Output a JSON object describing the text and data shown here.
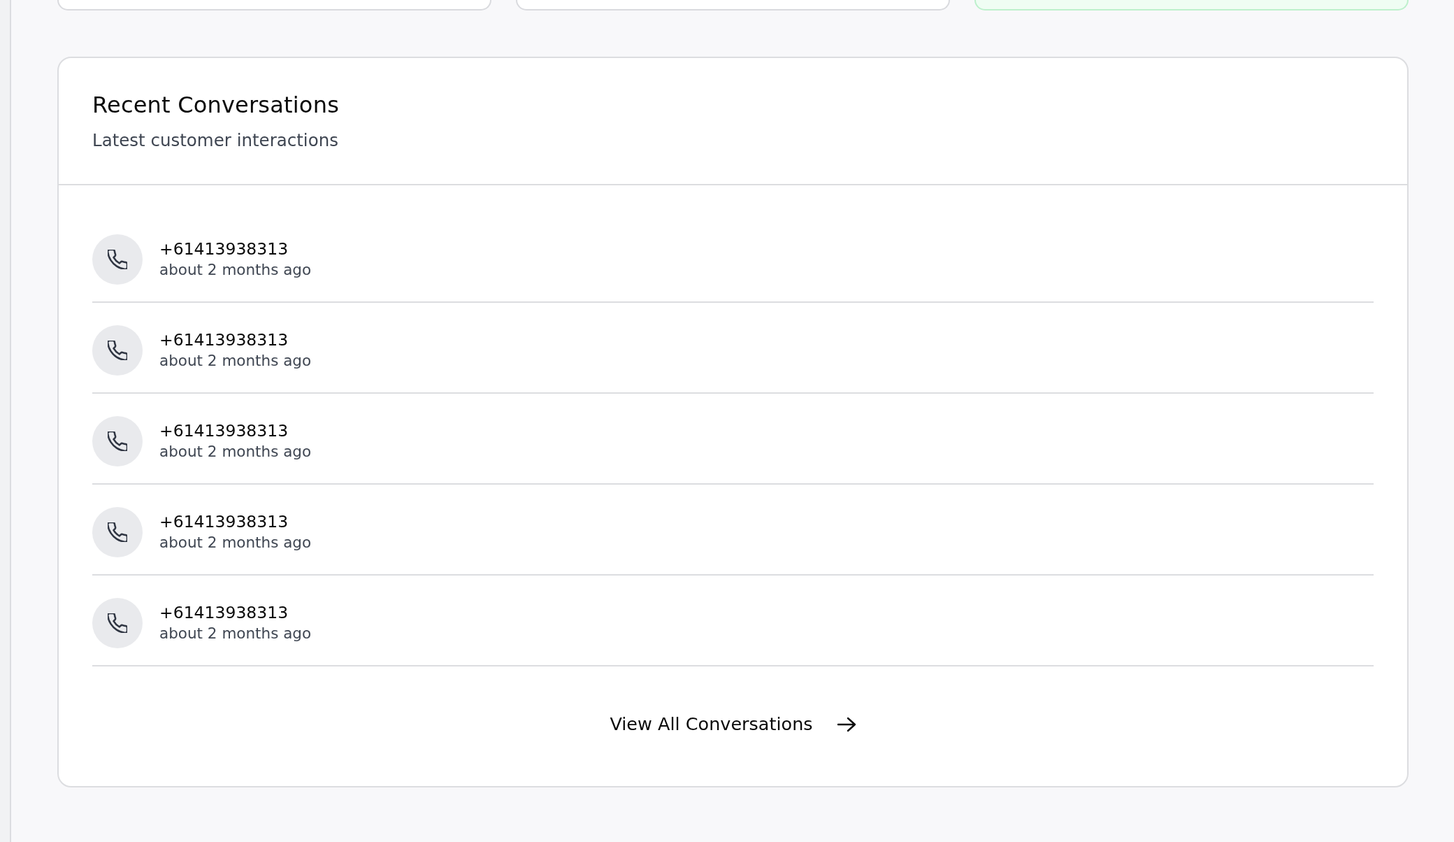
{
  "stat_cards": [
    {
      "highlighted": false
    },
    {
      "highlighted": false
    },
    {
      "highlighted": true
    }
  ],
  "conversations_card": {
    "title": "Recent Conversations",
    "subtitle": "Latest customer interactions",
    "conversations": [
      {
        "phone": "+61413938313",
        "time": "about 2 months ago"
      },
      {
        "phone": "+61413938313",
        "time": "about 2 months ago"
      },
      {
        "phone": "+61413938313",
        "time": "about 2 months ago"
      },
      {
        "phone": "+61413938313",
        "time": "about 2 months ago"
      },
      {
        "phone": "+61413938313",
        "time": "about 2 months ago"
      }
    ],
    "view_all_link": "View All Conversations"
  }
}
